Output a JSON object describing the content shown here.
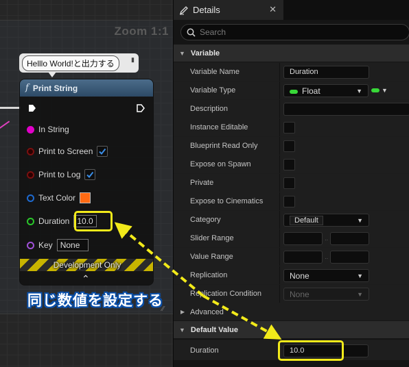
{
  "graph": {
    "zoom_label": "Zoom 1:1",
    "comment": "Helllo World!と出力する",
    "node": {
      "title": "Print String",
      "pins": {
        "in_string": "In String",
        "print_to_screen": "Print to Screen",
        "print_to_screen_checked": true,
        "print_to_log": "Print to Log",
        "print_to_log_checked": true,
        "text_color": "Text Color",
        "text_color_value": "#ff6a13",
        "duration": "Duration",
        "duration_value": "10.0",
        "key": "Key",
        "key_value": "None"
      },
      "dev_only": "Development Only"
    },
    "annotation": "同じ数値を設定する",
    "highlight_color": "#f2ea1a"
  },
  "details": {
    "tab_title": "Details",
    "search_placeholder": "Search",
    "sections": {
      "variable": "Variable",
      "advanced": "Advanced",
      "default_value": "Default Value"
    },
    "rows": {
      "variable_name": "Variable Name",
      "variable_name_value": "Duration",
      "variable_type": "Variable Type",
      "variable_type_value": "Float",
      "description": "Description",
      "instance_editable": "Instance Editable",
      "blueprint_read_only": "Blueprint Read Only",
      "expose_on_spawn": "Expose on Spawn",
      "private": "Private",
      "expose_to_cinematics": "Expose to Cinematics",
      "category": "Category",
      "category_value": "Default",
      "slider_range": "Slider Range",
      "value_range": "Value Range",
      "replication": "Replication",
      "replication_value": "None",
      "replication_condition": "Replication Condition",
      "replication_condition_value": "None",
      "duration": "Duration",
      "duration_value": "10.0"
    },
    "float_pin_color": "#38d838"
  }
}
